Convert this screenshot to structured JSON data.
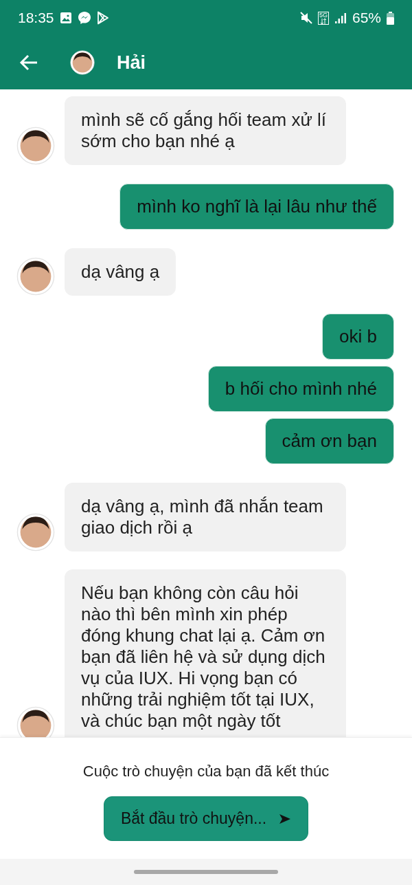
{
  "status_bar": {
    "time": "18:35",
    "network": "5G",
    "battery": "65%"
  },
  "header": {
    "title": "Hải"
  },
  "messages": [
    {
      "kind": "incoming",
      "text": "mình sẽ cố gắng hối team xử lí sớm cho bạn nhé ạ"
    },
    {
      "kind": "outgoing",
      "text": "mình ko nghĩ là lại lâu như thế"
    },
    {
      "kind": "incoming",
      "text": "dạ vâng ạ"
    },
    {
      "kind": "outgoing",
      "text": "oki b"
    },
    {
      "kind": "outgoing",
      "text": "b hối cho mình nhé"
    },
    {
      "kind": "outgoing",
      "text": "cảm ơn bạn"
    },
    {
      "kind": "incoming",
      "text": "dạ vâng ạ, mình đã nhắn team giao dịch rồi ạ"
    },
    {
      "kind": "incoming",
      "text": "Nếu bạn không còn câu hỏi nào thì bên mình xin phép đóng khung chat lại ạ. Cảm ơn bạn đã liên hệ và sử dụng dịch vụ của IUX. Hi vọng bạn có những trải nghiệm tốt tại IUX, và chúc bạn một ngày tốt"
    }
  ],
  "footer": {
    "notice": "Cuộc trò chuyện của bạn đã kết thúc",
    "button": "Bắt đầu trò chuyện..."
  }
}
